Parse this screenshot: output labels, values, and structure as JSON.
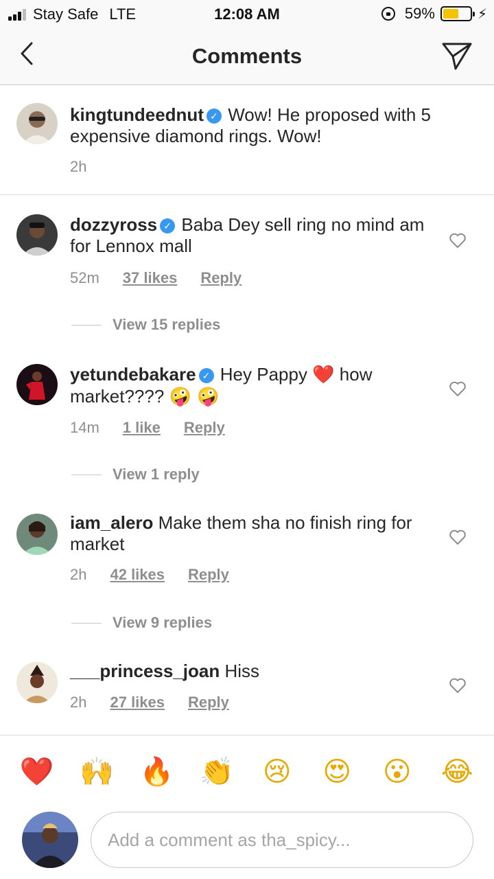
{
  "status_bar": {
    "carrier": "Stay Safe",
    "network": "LTE",
    "time": "12:08 AM",
    "battery": "59%",
    "battery_level": 0.59,
    "battery_color": "#f5c400"
  },
  "header": {
    "title": "Comments",
    "back_icon": "chevron-left-icon",
    "send_icon": "paper-plane-icon"
  },
  "caption": {
    "username": "kingtundeednut",
    "verified": true,
    "text": "Wow! He proposed with 5 expensive diamond rings. Wow!",
    "time": "2h"
  },
  "comments": [
    {
      "username": "dozzyross",
      "verified": true,
      "text": "Baba Dey sell ring no mind am for Lennox mall",
      "time": "52m",
      "likes": "37 likes",
      "reply": "Reply",
      "view_replies": "View 15 replies"
    },
    {
      "username": "yetundebakare",
      "verified": true,
      "text_a": "Hey Pappy ",
      "emoji_a": "❤️",
      "text_b": " how market???? ",
      "emoji_b": "🤪 🤪",
      "time": "14m",
      "likes": "1 like",
      "reply": "Reply",
      "view_replies": "View 1 reply"
    },
    {
      "username": "iam_alero",
      "verified": false,
      "text": "Make them sha no finish ring for market",
      "time": "2h",
      "likes": "42 likes",
      "reply": "Reply",
      "view_replies": "View 9 replies"
    },
    {
      "username": "___princess_joan",
      "verified": false,
      "text": "Hiss",
      "time": "2h",
      "likes": "27 likes",
      "reply": "Reply"
    }
  ],
  "reactions": [
    "❤️",
    "🙌",
    "🔥",
    "👏",
    "😢",
    "😍",
    "😮",
    "😂"
  ],
  "composer": {
    "placeholder": "Add a comment as tha_spicy..."
  },
  "colors": {
    "accent_verified": "#3897f0",
    "secondary_text": "#8e8e8e",
    "primary_text": "#262626"
  }
}
